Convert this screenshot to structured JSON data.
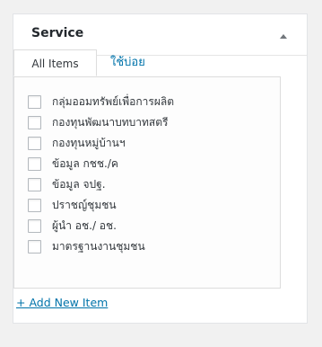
{
  "metabox": {
    "title": "Service",
    "tabs": {
      "all_items": "All Items",
      "most_used": "ใช้บ่อย"
    },
    "items": [
      {
        "label": "กลุ่มออมทรัพย์เพื่อการผลิต"
      },
      {
        "label": "กองทุนพัฒนาบทบาทสตรี"
      },
      {
        "label": "กองทุนหมู่บ้านฯ"
      },
      {
        "label": "ข้อมูล กชช./ค"
      },
      {
        "label": "ข้อมูล จปฐ."
      },
      {
        "label": "ปราชญ์ชุมชน"
      },
      {
        "label": "ผู้นำ อช./ อช."
      },
      {
        "label": "มาตรฐานงานชุมชน"
      }
    ],
    "add_new_label": "+ Add New Item"
  }
}
